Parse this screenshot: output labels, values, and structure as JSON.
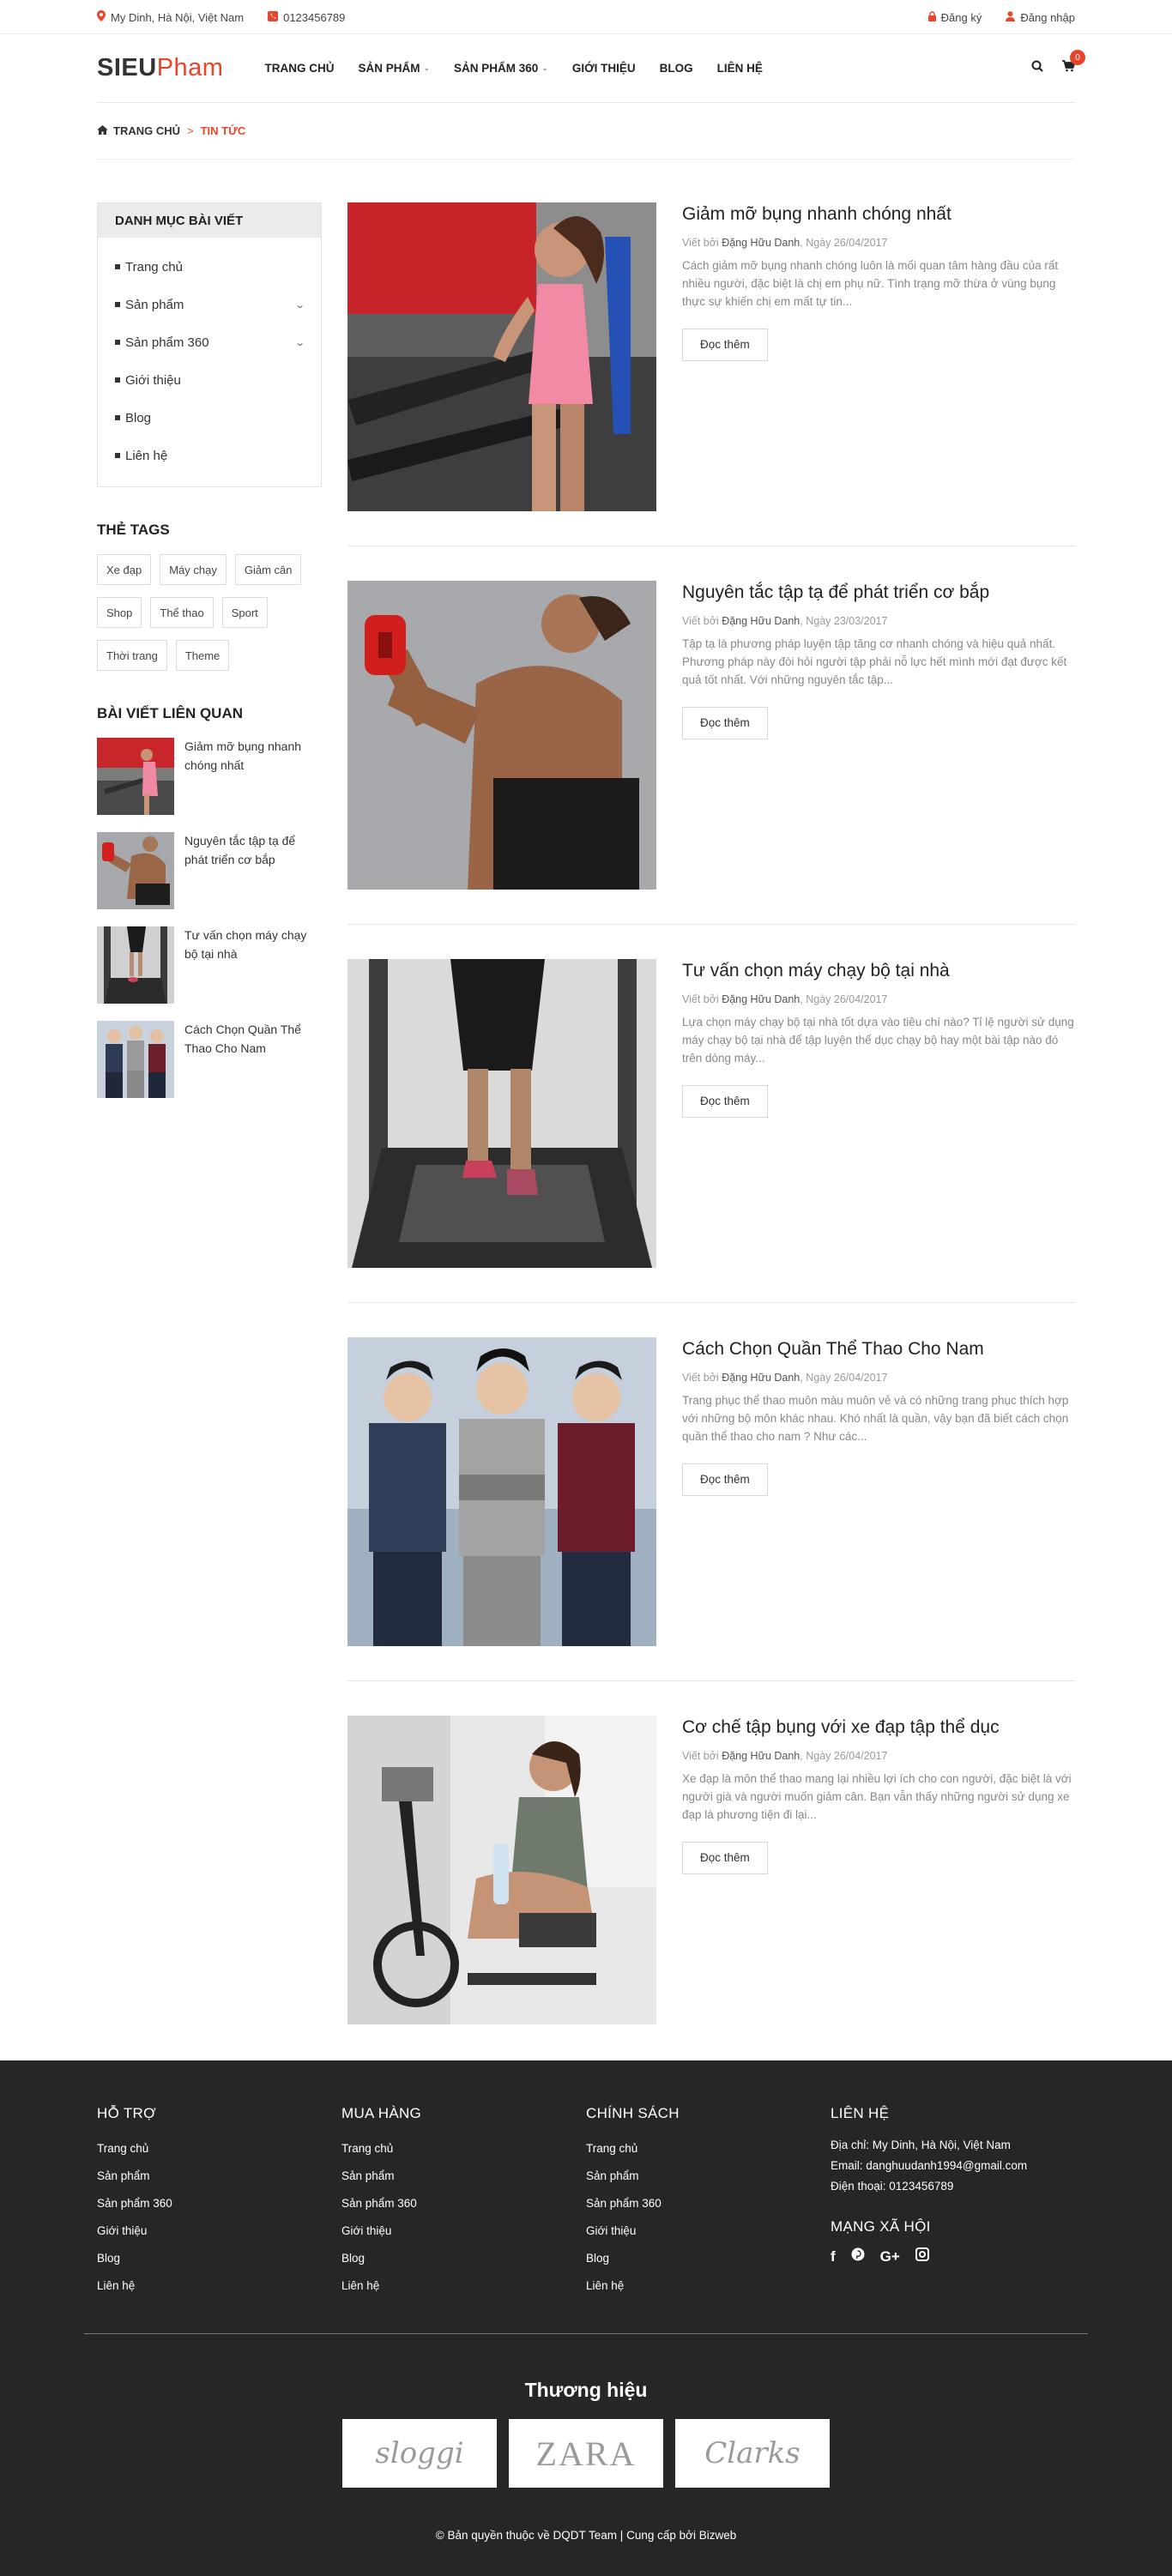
{
  "topbar": {
    "address": "My Dinh, Hà Nội, Việt Nam",
    "phone": "0123456789",
    "register": "Đăng ký",
    "login": "Đăng nhập"
  },
  "header": {
    "logo_part1": "SIEU",
    "logo_part2": "Pham",
    "nav": [
      "TRANG CHỦ",
      "SẢN PHẨM",
      "SẢN PHẨM 360",
      "GIỚI THIỆU",
      "BLOG",
      "LIÊN HỆ"
    ],
    "cart_count": "0"
  },
  "breadcrumb": {
    "home": "TRANG CHỦ",
    "separator": ">",
    "current": "TIN TỨC"
  },
  "sidebar": {
    "category_title": "DANH MỤC BÀI VIẾT",
    "categories": [
      "Trang chủ",
      "Sản phẩm",
      "Sản phẩm 360",
      "Giới thiệu",
      "Blog",
      "Liên hệ"
    ],
    "tags_title": "THẺ TAGS",
    "tags": [
      "Xe đạp",
      "Máy chạy",
      "Giảm cân",
      "Shop",
      "Thể thao",
      "Sport",
      "Thời trang",
      "Theme"
    ],
    "related_title": "BÀI VIẾT LIÊN QUAN",
    "related": [
      "Giảm mỡ bụng nhanh chóng nhất",
      "Nguyên tắc tập tạ để phát triển cơ bắp",
      "Tư vấn chọn máy chạy bộ tại nhà",
      "Cách Chọn Quần Thể Thao Cho Nam"
    ]
  },
  "posts": [
    {
      "title": "Giảm mỡ bụng nhanh chóng nhất",
      "by": "Viết bởi",
      "author": "Đặng Hữu Danh",
      "date": ", Ngày 26/04/2017",
      "excerpt": "Cách giảm mỡ bụng nhanh chóng luôn là mối quan tâm hàng đầu của rất nhiều người, đặc biệt là chị em phụ nữ. Tình trạng mỡ thừa ở vùng bụng thực sự khiến chị em mất tự tin...",
      "button": "Đọc thêm"
    },
    {
      "title": "Nguyên tắc tập tạ để phát triển cơ bắp",
      "by": "Viết bởi",
      "author": "Đặng Hữu Danh",
      "date": ", Ngày 23/03/2017",
      "excerpt": "Tập tạ là phương pháp luyện tập tăng cơ nhanh chóng và hiệu quả nhất. Phương pháp này đòi hỏi người tập phải nỗ lực hết mình mới đạt được kết quả tốt nhất. Với những nguyên tắc tập...",
      "button": "Đọc thêm"
    },
    {
      "title": "Tư vấn chọn máy chạy bộ tại nhà",
      "by": "Viết bởi",
      "author": "Đặng Hữu Danh",
      "date": ", Ngày 26/04/2017",
      "excerpt": "Lựa chọn máy chạy bộ tại nhà tốt dựa vào tiêu chí nào? Tỉ lệ người sử dụng máy chạy bộ tại nhà để tập luyện thể dục chạy bộ hay một bài tập nào đó trên dòng máy...",
      "button": "Đọc thêm"
    },
    {
      "title": "Cách Chọn Quần Thể Thao Cho Nam",
      "by": "Viết bởi",
      "author": "Đặng Hữu Danh",
      "date": ", Ngày 26/04/2017",
      "excerpt": "Trang phục thể thao muôn màu muôn vẻ và có những trang phục thích hợp với những bộ môn khác nhau. Khó nhất là quần, vậy bạn đã biết cách chọn quần thể thao cho nam ? Như các...",
      "button": "Đọc thêm"
    },
    {
      "title": "Cơ chế tập bụng với xe đạp tập thể dục",
      "by": "Viết bởi",
      "author": "Đặng Hữu Danh",
      "date": ", Ngày 26/04/2017",
      "excerpt": "Xe đạp là môn thể thao mang lại nhiều lợi ích cho con người, đặc biệt là với người già và người muốn giảm cân. Bạn vẫn thấy những người sử dụng xe đạp là phương tiện đi lại...",
      "button": "Đọc thêm"
    }
  ],
  "footer": {
    "support_title": "HỖ TRỢ",
    "purchase_title": "MUA HÀNG",
    "policy_title": "CHÍNH SÁCH",
    "contact_title": "LIÊN HỆ",
    "links": [
      "Trang chủ",
      "Sản phẩm",
      "Sản phẩm 360",
      "Giới thiệu",
      "Blog",
      "Liên hệ"
    ],
    "address": "Địa chỉ: My Dinh, Hà Nội, Việt Nam",
    "email": "Email: danghuudanh1994@gmail.com",
    "phone": "Điện thoại: 0123456789",
    "social_title": "MẠNG XÃ HỘI",
    "brands_title": "Thương hiệu",
    "brands": [
      "sloggi",
      "ZARA",
      "Clarks"
    ],
    "copyright": "© Bản quyền thuộc về DQDT Team | Cung cấp bởi Bizweb"
  },
  "colors": {
    "accent": "#e8452c",
    "footer_bg": "#262626"
  }
}
